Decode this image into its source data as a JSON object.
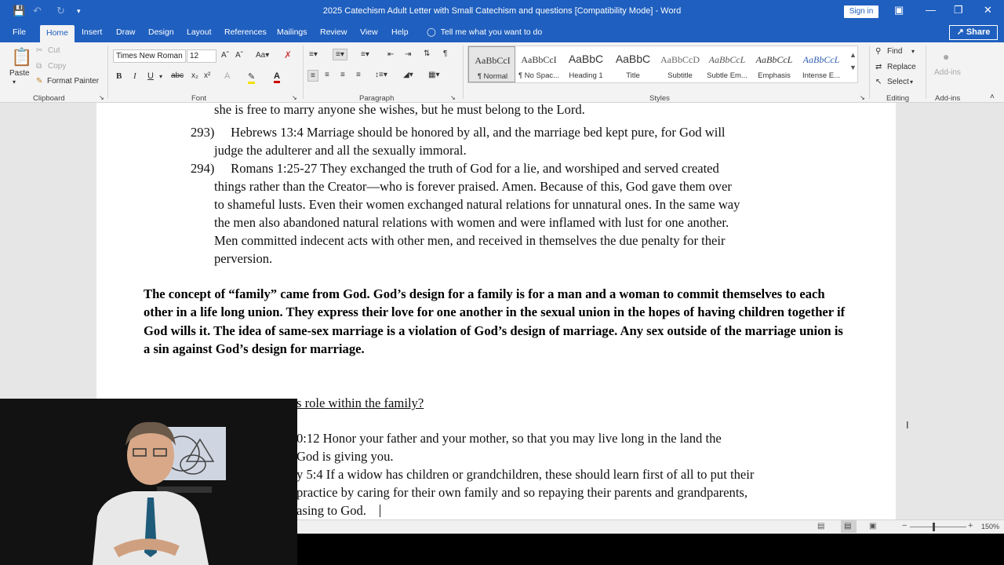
{
  "titlebar": {
    "title": "2025 Catechism Adult Letter with Small Catechism and questions [Compatibility Mode] - Word",
    "signin": "Sign in",
    "autosave_icon": "save-icon"
  },
  "tabs": [
    "File",
    "Home",
    "Insert",
    "Draw",
    "Design",
    "Layout",
    "References",
    "Mailings",
    "Review",
    "View",
    "Help"
  ],
  "tellme": "Tell me what you want to do",
  "share": "Share",
  "clipboard": {
    "paste": "Paste",
    "cut": "Cut",
    "copy": "Copy",
    "format_painter": "Format Painter",
    "group": "Clipboard"
  },
  "font": {
    "name": "Times New Roman",
    "size": "12",
    "group": "Font"
  },
  "paragraph": {
    "group": "Paragraph"
  },
  "styles": {
    "group": "Styles",
    "items": [
      {
        "preview": "AaBbCcI",
        "name": "¶ Normal"
      },
      {
        "preview": "AaBbCcI",
        "name": "¶ No Spac..."
      },
      {
        "preview": "AaBbC",
        "name": "Heading 1"
      },
      {
        "preview": "AaBbC",
        "name": "Title"
      },
      {
        "preview": "AaBbCcD",
        "name": "Subtitle"
      },
      {
        "preview": "AaBbCcL",
        "name": "Subtle Em..."
      },
      {
        "preview": "AaBbCcL",
        "name": "Emphasis"
      },
      {
        "preview": "AaBbCcL",
        "name": "Intense E..."
      }
    ]
  },
  "editing": {
    "find": "Find",
    "replace": "Replace",
    "select": "Select",
    "group": "Editing"
  },
  "addins": {
    "label": "Add-ins",
    "group": "Add-ins"
  },
  "document": {
    "lines": [
      "she is free to marry anyone she wishes, but he must belong to the Lord.",
      "293)  Hebrews 13:4 Marriage should be honored by all, and the marriage bed kept pure, for God will",
      "judge the adulterer and all the sexually immoral.",
      "294)  Romans 1:25-27 They exchanged the truth of God for a lie, and worshiped and served created",
      "things rather than the Creator—who is forever praised. Amen. Because of this, God gave them over",
      "to shameful lusts. Even their women exchanged natural relations for unnatural ones. In the same way",
      "the men also abandoned natural relations with women and were inflamed with lust for one another.",
      "Men committed indecent acts with other men, and received in themselves the due penalty for their",
      "perversion."
    ],
    "bold_paragraph": "The concept of “family” came from God.  God’s design for a family is for a man and a woman to commit themselves to each other in a life long union.  They express their love for one another in the sexual union in the hopes of having children together if God wills it.  The idea of same-sex marriage is a violation of God’s design of marriage.  Any sex outside of the marriage union is a sin against God’s design for marriage.",
    "question": "s role within the family?",
    "partial_lines": [
      "0:12 Honor your father and your mother, so that you may live long in the land the",
      "God is giving you.",
      "y 5:4 If a widow has children or grandchildren, these should learn first of all to put their",
      "practice by caring for their own family and so repaying their parents and grandparents,",
      "asing to God."
    ]
  },
  "statusbar": {
    "zoom": "150%"
  }
}
